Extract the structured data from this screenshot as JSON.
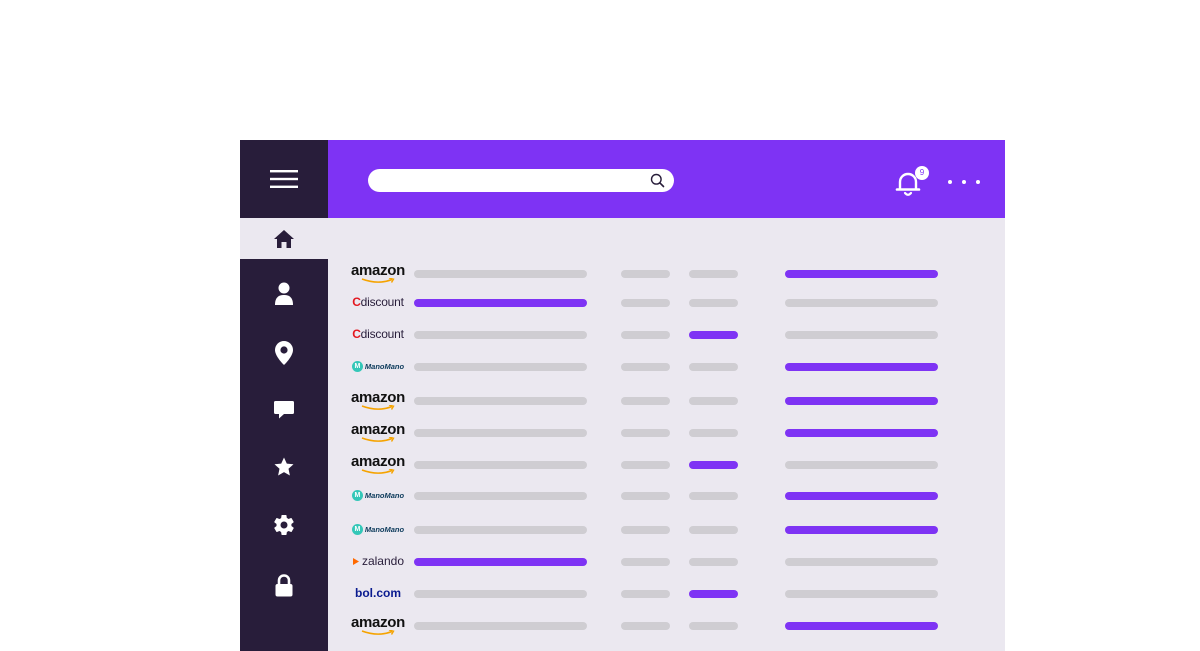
{
  "search": {
    "value": "",
    "placeholder": ""
  },
  "notifications": {
    "count": "9"
  },
  "colors": {
    "accent": "#7e33f4",
    "sidebar": "#281d3a",
    "content": "#ebe8f0",
    "bar": "#cfcdd2"
  },
  "sidebar": {
    "items": [
      {
        "icon": "menu-icon"
      },
      {
        "icon": "home-icon",
        "active": true
      },
      {
        "icon": "user-icon"
      },
      {
        "icon": "location-pin-icon"
      },
      {
        "icon": "chat-icon"
      },
      {
        "icon": "star-icon"
      },
      {
        "icon": "gear-icon"
      },
      {
        "icon": "lock-icon"
      }
    ]
  },
  "logos": {
    "amazon": "amazon",
    "cdiscount_c": "C",
    "cdiscount_rest": "discount",
    "manomano_m": "M",
    "manomano": "ManoMano",
    "zalando": "zalando",
    "bol": "bol.com"
  },
  "rows": [
    {
      "store": "amazon",
      "highlight": 3
    },
    {
      "store": "cdiscount",
      "highlight": 0
    },
    {
      "store": "cdiscount",
      "highlight": 2
    },
    {
      "store": "manomano",
      "highlight": 3
    },
    {
      "store": "amazon",
      "highlight": 3
    },
    {
      "store": "amazon",
      "highlight": 3
    },
    {
      "store": "amazon",
      "highlight": 2
    },
    {
      "store": "manomano",
      "highlight": 3
    },
    {
      "store": "manomano",
      "highlight": 3
    },
    {
      "store": "zalando",
      "highlight": 0
    },
    {
      "store": "bol",
      "highlight": 2
    },
    {
      "store": "amazon",
      "highlight": 3
    }
  ]
}
